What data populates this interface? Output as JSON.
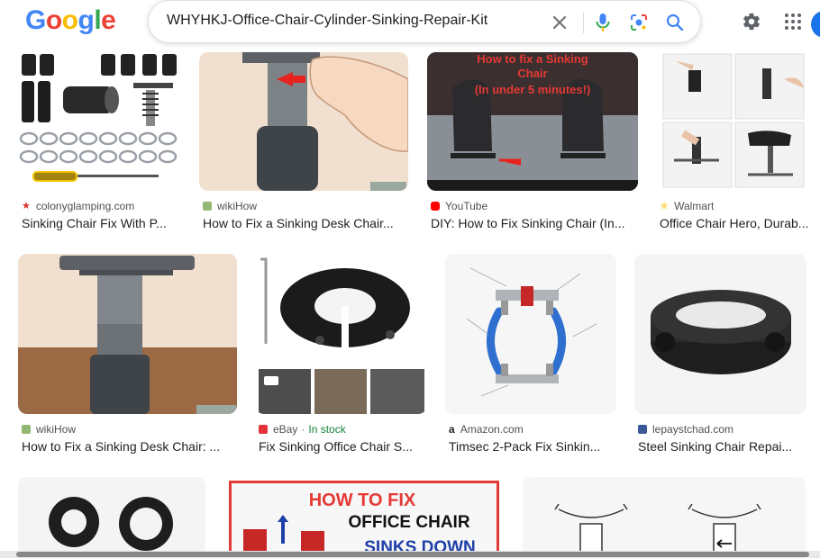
{
  "header": {
    "logo_letters": [
      "G",
      "o",
      "o",
      "g",
      "l",
      "e"
    ],
    "logo_colors": [
      "#4285F4",
      "#EA4335",
      "#FBBC05",
      "#4285F4",
      "#34A853",
      "#EA4335"
    ],
    "search_value": "WHYHKJ-Office-Chair-Cylinder-Sinking-Repair-Kit"
  },
  "results": [
    {
      "source": "colonyglamping.com",
      "title": "Sinking Chair Fix With P...",
      "fav_color": "#d93025"
    },
    {
      "source": "wikiHow",
      "title": "How to Fix a Sinking Desk Chair...",
      "fav_color": "#93b874"
    },
    {
      "source": "YouTube",
      "title": "DIY: How to Fix Sinking Chair (In...",
      "fav_color": "#ff0000"
    },
    {
      "source": "Walmart",
      "title": "Office Chair Hero, Durab...",
      "fav_color": "#ffc220"
    },
    {
      "source": "wikiHow",
      "title": "How to Fix a Sinking Desk Chair: ...",
      "fav_color": "#93b874"
    },
    {
      "source": "eBay",
      "stock": "In stock",
      "title": "Fix Sinking Office Chair S...",
      "fav_color": "#e53238"
    },
    {
      "source": "Amazon.com",
      "title": "Timsec 2-Pack Fix Sinkin...",
      "fav_color": "#222222"
    },
    {
      "source": "lepaystchad.com",
      "title": "Steel Sinking Chair Repai...",
      "fav_color": "#3b5998"
    }
  ],
  "image_text": {
    "youtube_thumb_line1": "How to fix a Sinking",
    "youtube_thumb_line2": "Chair",
    "youtube_thumb_line3": "(In under 5 minutes!)",
    "wikihow_badge": "wikiHow",
    "howto_line1": "HOW TO FIX",
    "howto_line2": "OFFICE CHAIR",
    "howto_line3": "SINKS DOWN"
  }
}
